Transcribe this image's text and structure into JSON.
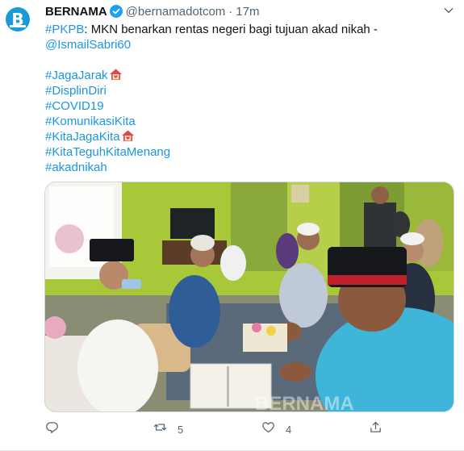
{
  "tweet": {
    "author": {
      "display_name": "BERNAMA",
      "handle": "@bernamadotcom",
      "verified": true,
      "avatar_letter": "B",
      "avatar_color": "#1a9ad6"
    },
    "separator": "·",
    "time": "17m",
    "text": {
      "hashtag": "#PKPB",
      "main": ": MKN benarkan rentas negeri bagi tujuan akad nikah -",
      "mention": "@IsmailSabri60"
    },
    "hashtags": [
      {
        "text": "#JagaJarak",
        "emoji": "house-with-heart"
      },
      {
        "text": "#DisplinDiri"
      },
      {
        "text": "#COVID19"
      },
      {
        "text": "#KomunikasiKita"
      },
      {
        "text": "#KitaJagaKita",
        "emoji": "house-with-heart"
      },
      {
        "text": "#KitaTeguhKitaMenang"
      },
      {
        "text": "#akadnikah"
      }
    ],
    "media": {
      "watermark": "BERNAMA",
      "description_icon": "photo"
    },
    "actions": {
      "reply_icon": "reply-icon",
      "retweet_count": "5",
      "like_count": "4",
      "share_icon": "share-icon"
    },
    "colors": {
      "link": "#1b95e0",
      "verified": "#1da1f2",
      "muted": "#536471"
    }
  }
}
